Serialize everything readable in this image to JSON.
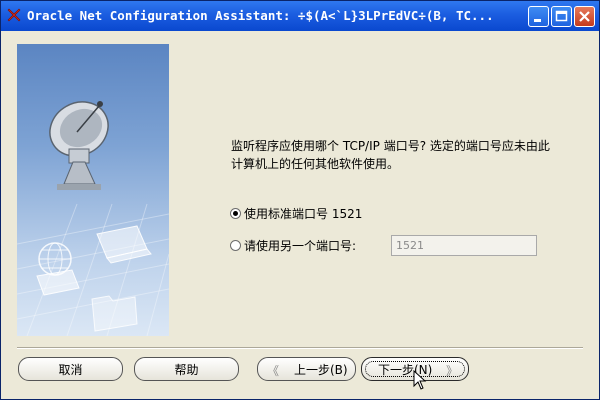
{
  "window": {
    "title": "Oracle Net Configuration Assistant: ÷$(A<`L}3LPrEdVC÷(B, TC...",
    "controls": [
      "minimize-icon",
      "maximize-icon",
      "close-icon"
    ]
  },
  "prompt": {
    "text": "监听程序应使用哪个 TCP/IP 端口号? 选定的端口号应未由此计算机上的任何其他软件使用。"
  },
  "options": {
    "standard": {
      "label": "使用标准端口号 1521",
      "checked": true
    },
    "other": {
      "label": "请使用另一个端口号:",
      "checked": false,
      "value": "1521"
    }
  },
  "buttons": {
    "cancel": "取消",
    "help": "帮助",
    "back": "上一步(B)",
    "next": "下一步(N)"
  },
  "colors": {
    "titlebar": "#0a48cf",
    "dialog_bg": "#ece9d8",
    "art_top": "#5b85c2",
    "art_bottom": "#dbe7f5"
  }
}
